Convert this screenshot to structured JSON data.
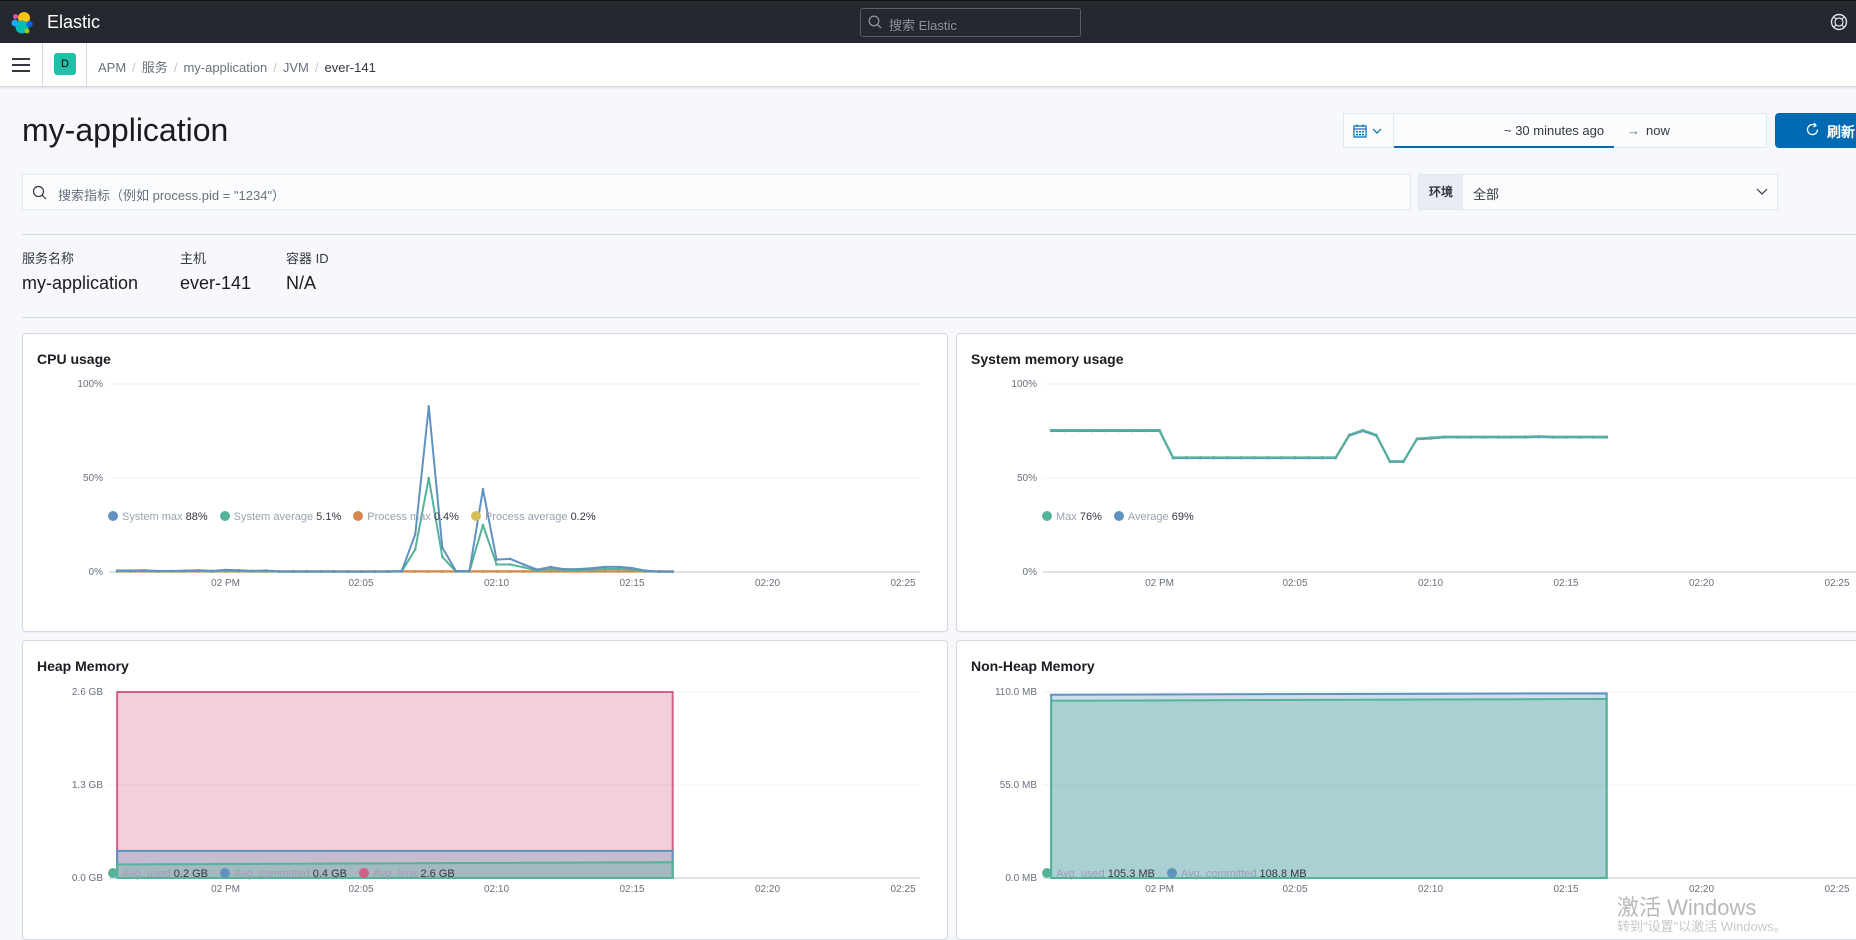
{
  "header": {
    "brand": "Elastic",
    "search_placeholder": "搜索 Elastic",
    "help_icon": "help-icon"
  },
  "breadcrumb": {
    "space_initial": "D",
    "items": [
      "APM",
      "服务",
      "my-application",
      "JVM",
      "ever-141"
    ]
  },
  "page": {
    "title": "my-application"
  },
  "datepicker": {
    "quick_icon": "calendar-icon",
    "start": "~ 30 minutes ago",
    "arrow": "→",
    "end": "now",
    "refresh_label": "刷新"
  },
  "filters": {
    "kql_placeholder": "搜索指标（例如 process.pid = \"1234\"）",
    "env_prepend": "环境",
    "env_value": "全部"
  },
  "metadata": [
    {
      "label": "服务名称",
      "value": "my-application"
    },
    {
      "label": "主机",
      "value": "ever-141"
    },
    {
      "label": "容器 ID",
      "value": "N/A"
    }
  ],
  "chart_data": [
    {
      "type": "line",
      "title": "CPU usage",
      "x_start": "13:56",
      "x_step_minutes": 0.5,
      "x_range_minutes": [
        -4.3,
        26.5
      ],
      "x_ticks": [
        {
          "label": "02 PM",
          "t": 0
        },
        {
          "label": "02:05",
          "t": 5
        },
        {
          "label": "02:10",
          "t": 10
        },
        {
          "label": "02:15",
          "t": 15
        },
        {
          "label": "02:20",
          "t": 20
        },
        {
          "label": "02:25",
          "t": 25
        }
      ],
      "y_ticks": [
        "0%",
        "50%",
        "100%"
      ],
      "ylim": [
        0,
        100
      ],
      "unit": "%",
      "series": [
        {
          "name": "System max",
          "color": "#6092c0",
          "summary": "88%",
          "values": [
            0.8,
            0.8,
            0.9,
            0.5,
            0.5,
            0.7,
            0.9,
            0.6,
            1.1,
            0.9,
            0.6,
            0.8,
            0.3,
            0.3,
            0.3,
            0.3,
            0.3,
            0.2,
            0.2,
            0.2,
            0.3,
            0.5,
            20,
            88,
            13,
            0.5,
            0.5,
            44,
            6.6,
            7,
            4,
            1.3,
            2.7,
            1.5,
            1.5,
            2,
            2.7,
            2.7,
            2.1,
            0.7,
            0.3,
            0.1
          ]
        },
        {
          "name": "System average",
          "color": "#54b399",
          "summary": "5.1%",
          "values": [
            0.5,
            0.5,
            0.6,
            0.4,
            0.4,
            0.5,
            0.6,
            0.4,
            0.7,
            0.6,
            0.4,
            0.5,
            0.2,
            0.2,
            0.2,
            0.2,
            0.2,
            0.2,
            0.2,
            0.2,
            0.2,
            0.3,
            12,
            50,
            8,
            0.3,
            0.3,
            25,
            4,
            4,
            2.5,
            0.8,
            1.6,
            1,
            1,
            1.2,
            1.6,
            1.6,
            1.3,
            0.4,
            0.2,
            0.1
          ]
        },
        {
          "name": "Process max",
          "color": "#d6864e",
          "summary": "0.4%",
          "values": [
            0.4,
            0.4,
            0.4,
            0.4,
            0.4,
            0.4,
            0.4,
            0.4,
            0.4,
            0.4,
            0.4,
            0.4,
            0.4,
            0.4,
            0.4,
            0.4,
            0.4,
            0.4,
            0.4,
            0.4,
            0.4,
            0.4,
            0.4,
            0.4,
            0.4,
            0.4,
            0.4,
            0.4,
            0.4,
            0.4,
            0.4,
            0.4,
            0.4,
            0.4,
            0.4,
            0.4,
            0.4,
            0.4,
            0.4,
            0.4,
            0.4,
            0.4
          ]
        },
        {
          "name": "Process average",
          "color": "#d6bf57",
          "summary": "0.2%",
          "values": [
            0.2,
            0.2,
            0.2,
            0.2,
            0.2,
            0.2,
            0.2,
            0.2,
            0.2,
            0.2,
            0.2,
            0.2,
            0.2,
            0.2,
            0.2,
            0.2,
            0.2,
            0.2,
            0.2,
            0.2,
            0.2,
            0.2,
            0.2,
            0.2,
            0.2,
            0.2,
            0.2,
            0.2,
            0.2,
            0.2,
            0.2,
            0.2,
            0.2,
            0.2,
            0.2,
            0.2,
            0.2,
            0.2,
            0.2,
            0.2,
            0.2,
            0.2
          ]
        }
      ]
    },
    {
      "type": "line",
      "title": "System memory usage",
      "x_start": "13:56",
      "x_step_minutes": 0.5,
      "x_range_minutes": [
        -4.3,
        26.5
      ],
      "x_ticks": [
        {
          "label": "02 PM",
          "t": 0
        },
        {
          "label": "02:05",
          "t": 5
        },
        {
          "label": "02:10",
          "t": 10
        },
        {
          "label": "02:15",
          "t": 15
        },
        {
          "label": "02:20",
          "t": 20
        },
        {
          "label": "02:25",
          "t": 25
        }
      ],
      "y_ticks": [
        "0%",
        "50%",
        "100%"
      ],
      "ylim": [
        0,
        100
      ],
      "unit": "%",
      "series": [
        {
          "name": "Max",
          "color": "#54b399",
          "summary": "76%",
          "values": [
            75.5,
            75.5,
            75.5,
            75.5,
            75.5,
            75.5,
            75.5,
            75.5,
            75.5,
            61,
            61,
            61,
            61,
            61,
            61,
            61,
            61,
            61,
            61,
            61,
            61,
            61,
            73,
            75.5,
            73,
            59,
            59,
            71,
            71.5,
            72,
            72,
            72,
            72,
            72,
            72,
            72,
            72.2,
            72,
            72,
            72,
            72,
            72
          ]
        },
        {
          "name": "Average",
          "color": "#6092c0",
          "summary": "69%",
          "values": [
            75,
            75,
            75,
            75,
            75,
            75,
            75,
            75,
            75,
            60.6,
            60.6,
            60.6,
            60.6,
            60.6,
            60.6,
            60.6,
            60.6,
            60.6,
            60.6,
            60.6,
            60.6,
            60.6,
            72.5,
            75,
            72.5,
            58.6,
            58.6,
            70.6,
            71,
            71.6,
            71.6,
            71.6,
            71.6,
            71.6,
            71.6,
            71.6,
            71.8,
            71.6,
            71.6,
            71.6,
            71.6,
            71.6
          ]
        }
      ]
    },
    {
      "type": "area",
      "title": "Heap Memory",
      "x_start": "13:56",
      "x_step_minutes": 0.5,
      "x_range_minutes": [
        -4.3,
        26.5
      ],
      "x_ticks": [
        {
          "label": "02 PM",
          "t": 0
        },
        {
          "label": "02:05",
          "t": 5
        },
        {
          "label": "02:10",
          "t": 10
        },
        {
          "label": "02:15",
          "t": 15
        },
        {
          "label": "02:20",
          "t": 20
        },
        {
          "label": "02:25",
          "t": 25
        }
      ],
      "y_ticks": [
        "0.0 GB",
        "1.3 GB",
        "2.6 GB"
      ],
      "ylim": [
        0,
        2.6
      ],
      "unit": "GB",
      "series": [
        {
          "name": "Avg. limit",
          "color": "#d36086",
          "summary": "2.6 GB",
          "from": 2.6,
          "to": 2.6
        },
        {
          "name": "Avg. committed",
          "color": "#6092c0",
          "summary": "0.4 GB",
          "from": 0.38,
          "to": 0.38
        },
        {
          "name": "Avg. used",
          "color": "#54b399",
          "summary": "0.2 GB",
          "from": 0.19,
          "to": 0.22
        }
      ],
      "legend_order": [
        "Avg. used",
        "Avg. committed",
        "Avg. limit"
      ]
    },
    {
      "type": "area",
      "title": "Non-Heap Memory",
      "x_start": "13:56",
      "x_step_minutes": 0.5,
      "x_range_minutes": [
        -4.3,
        26.5
      ],
      "x_ticks": [
        {
          "label": "02 PM",
          "t": 0
        },
        {
          "label": "02:05",
          "t": 5
        },
        {
          "label": "02:10",
          "t": 10
        },
        {
          "label": "02:15",
          "t": 15
        },
        {
          "label": "02:20",
          "t": 20
        },
        {
          "label": "02:25",
          "t": 25
        }
      ],
      "y_ticks": [
        "0.0 MB",
        "55.0 MB",
        "110.0 MB"
      ],
      "ylim": [
        0,
        110
      ],
      "unit": "MB",
      "series": [
        {
          "name": "Avg. committed",
          "color": "#6092c0",
          "summary": "108.8 MB",
          "from": 108.4,
          "to": 109.2
        },
        {
          "name": "Avg. used",
          "color": "#54b399",
          "summary": "105.3 MB",
          "from": 104.8,
          "to": 105.9
        }
      ],
      "legend_order": [
        "Avg. used",
        "Avg. committed"
      ]
    }
  ],
  "watermark": {
    "line1": "激活 Windows",
    "line2": "转到\"设置\"以激活 Windows。"
  }
}
